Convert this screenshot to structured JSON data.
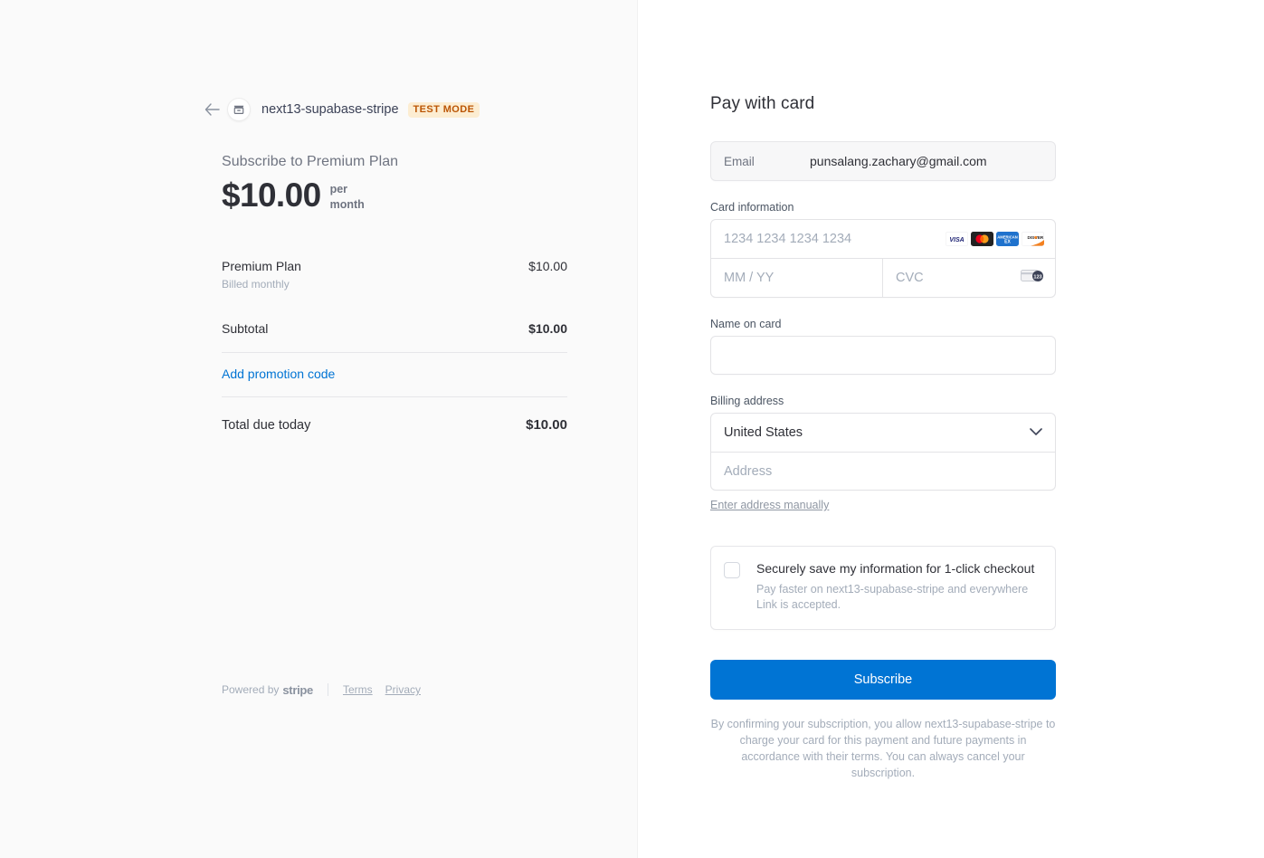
{
  "merchant": {
    "back_icon": "back-arrow-icon",
    "logo_icon": "storefront-icon",
    "name": "next13-supabase-stripe",
    "test_badge": "TEST MODE"
  },
  "summary": {
    "heading": "Subscribe to Premium Plan",
    "amount": "$10.00",
    "interval": "per month",
    "line_item": {
      "name": "Premium Plan",
      "sub": "Billed monthly",
      "price": "$10.00"
    },
    "subtotal_label": "Subtotal",
    "subtotal_price": "$10.00",
    "promo_label": "Add promotion code",
    "total_label": "Total due today",
    "total_price": "$10.00"
  },
  "footer": {
    "powered_by": "Powered by",
    "brand": "stripe",
    "terms": "Terms",
    "privacy": "Privacy"
  },
  "payment": {
    "title": "Pay with card",
    "email_label": "Email",
    "email_value": "punsalang.zachary@gmail.com",
    "card_info_label": "Card information",
    "card_number_placeholder": "1234 1234 1234 1234",
    "expiry_placeholder": "MM / YY",
    "cvc_placeholder": "CVC",
    "card_brands": [
      "visa-icon",
      "mastercard-icon",
      "amex-icon",
      "discover-icon"
    ],
    "cvc_icon": "cvc-card-icon",
    "name_label": "Name on card",
    "name_value": "",
    "billing_label": "Billing address",
    "country_value": "United States",
    "country_chevron": "chevron-down-icon",
    "address_placeholder": "Address",
    "manual_link": "Enter address manually",
    "save_title": "Securely save my information for 1-click checkout",
    "save_sub": "Pay faster on next13-supabase-stripe and everywhere Link is accepted.",
    "submit_label": "Subscribe",
    "terms_text": "By confirming your subscription, you allow next13-supabase-stripe to charge your card for this payment and future payments in accordance with their terms. You can always cancel your subscription."
  },
  "colors": {
    "accent": "#0074d4",
    "badge_bg": "#fcedd2",
    "badge_text": "#bb5504",
    "panel_bg": "#fafafa"
  }
}
